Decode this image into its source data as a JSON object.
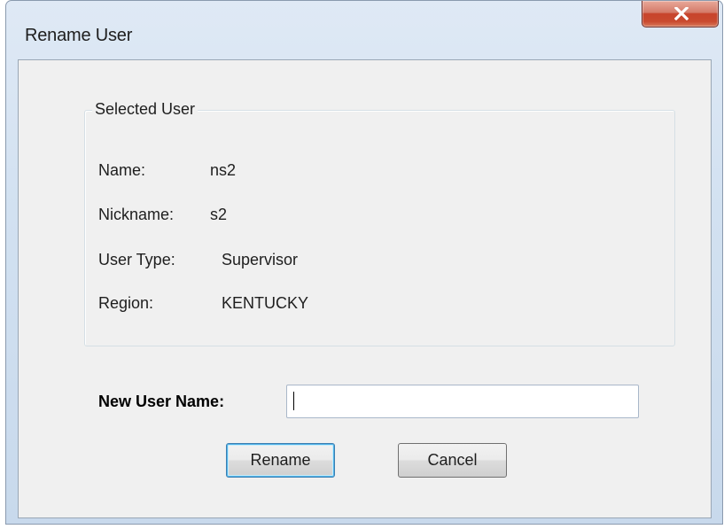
{
  "window": {
    "title": "Rename User"
  },
  "selected_user": {
    "legend": "Selected User",
    "fields": [
      {
        "label": "Name:",
        "value": "ns2"
      },
      {
        "label": "Nickname:",
        "value": "s2"
      },
      {
        "label": "User Type:",
        "value": "Supervisor"
      },
      {
        "label": "Region:",
        "value": "KENTUCKY"
      }
    ]
  },
  "form": {
    "new_name_label": "New User Name:",
    "new_name_value": ""
  },
  "buttons": {
    "rename": "Rename",
    "cancel": "Cancel"
  },
  "icons": {
    "close": "close-icon"
  }
}
